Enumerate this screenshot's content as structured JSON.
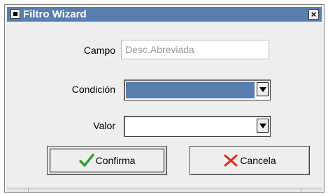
{
  "window": {
    "title": "Filtro Wizard",
    "close_glyph": "×"
  },
  "form": {
    "campo": {
      "label": "Campo",
      "value": "Desc.Abreviada"
    },
    "condicion": {
      "label": "Condición",
      "value": ""
    },
    "valor": {
      "label": "Valor",
      "value": ""
    }
  },
  "buttons": {
    "confirm": {
      "label": "Confirma",
      "icon": "checkmark-icon"
    },
    "cancel": {
      "label": "Cancela",
      "icon": "x-mark-icon"
    }
  },
  "colors": {
    "titlebar": "#5a7db0",
    "selected_highlight": "#5a7db0",
    "checkmark": "#2fa02f",
    "xmark": "#e0281e"
  }
}
